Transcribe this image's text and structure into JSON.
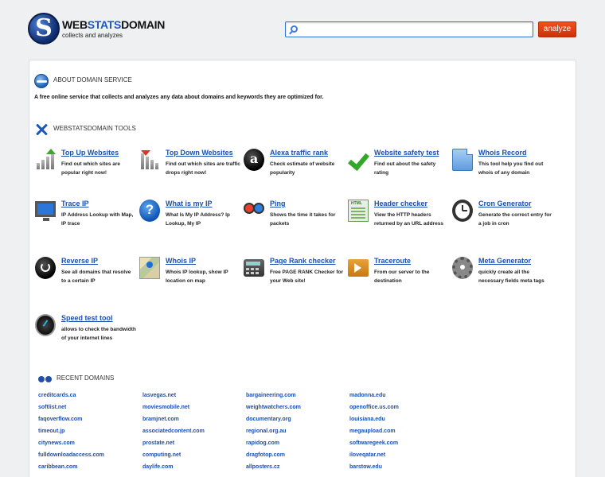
{
  "header": {
    "logo_letter": "S",
    "logo_name_part1": "WEB",
    "logo_name_part2": "STATS",
    "logo_name_part3": "DOMAIN",
    "tagline": "collects and analyzes",
    "search_placeholder": "",
    "analyze_label": "analyze"
  },
  "about": {
    "title": "About domain service",
    "description": "A free online service that collects and analyzes any data about domains and keywords they are optimized for."
  },
  "tools": {
    "title": "Webstatsdomain tools",
    "items": [
      {
        "name": "Top Up Websites",
        "desc": "Find out which sites are popular right now!",
        "icon": "chart-up-icon"
      },
      {
        "name": "Top Down Websites",
        "desc": "Find out which sites are traffic drops right now!",
        "icon": "chart-down-icon"
      },
      {
        "name": "Alexa traffic rank",
        "desc": "Check estimate of website popularity",
        "icon": "alexa-icon"
      },
      {
        "name": "Website safety test",
        "desc": "Find out about the safety rating",
        "icon": "checkmark-icon"
      },
      {
        "name": "Whois Record",
        "desc": "This tool help you find out whois of any domain",
        "icon": "document-icon"
      },
      {
        "name": "Trace IP",
        "desc": "IP Address Lookup with Map, IP trace",
        "icon": "monitor-icon"
      },
      {
        "name": "What is my IP",
        "desc": "What Is My IP Address? Ip Lookup, My IP",
        "icon": "question-icon"
      },
      {
        "name": "Ping",
        "desc": "Shows the time it takes for packets",
        "icon": "ping-arrows-icon"
      },
      {
        "name": "Header checker",
        "desc": "View the HTTP headers returned by an URL address",
        "icon": "html-document-icon"
      },
      {
        "name": "Cron Generator",
        "desc": "Generate the correct entry for a job in cron",
        "icon": "clock-icon"
      },
      {
        "name": "Reverse IP",
        "desc": "See all domains that resolve to a certain IP",
        "icon": "reverse-icon"
      },
      {
        "name": "Whois IP",
        "desc": "Whois IP lookup, show IP location on map",
        "icon": "map-icon"
      },
      {
        "name": "Page Rank checker",
        "desc": "Free PAGE RANK Checker for your Web site!",
        "icon": "calculator-icon"
      },
      {
        "name": "Traceroute",
        "desc": "From our server to the destination",
        "icon": "route-icon"
      },
      {
        "name": "Meta Generator",
        "desc": "quickly create all the necessary fields meta tags",
        "icon": "gear-icon"
      },
      {
        "name": "Speed test tool",
        "desc": "allows to check the bandwidth of your internet lines",
        "icon": "speedometer-icon"
      }
    ]
  },
  "recent": {
    "title": "Recent domains",
    "columns": [
      [
        "creditcards.ca",
        "softlist.net",
        "faqoverflow.com",
        "timeout.jp",
        "citynews.com",
        "fulldownloadaccess.com",
        "caribbean.com"
      ],
      [
        "lasvegas.net",
        "moviesmobile.net",
        "bramjnet.com",
        "associatedcontent.com",
        "prostate.net",
        "computing.net",
        "daylife.com"
      ],
      [
        "bargaineering.com",
        "weightwatchers.com",
        "documentary.org",
        "regional.org.au",
        "rapidog.com",
        "dragfotop.com",
        "allposters.cz"
      ],
      [
        "madonna.edu",
        "openoffice.us.com",
        "louisiana.edu",
        "megaupload.com",
        "softwaregeek.com",
        "iloveqatar.net",
        "barstow.edu"
      ]
    ]
  },
  "colors": {
    "link": "#1a4fb0",
    "accent": "#cc3208",
    "brand_blue": "#1f56c0"
  }
}
